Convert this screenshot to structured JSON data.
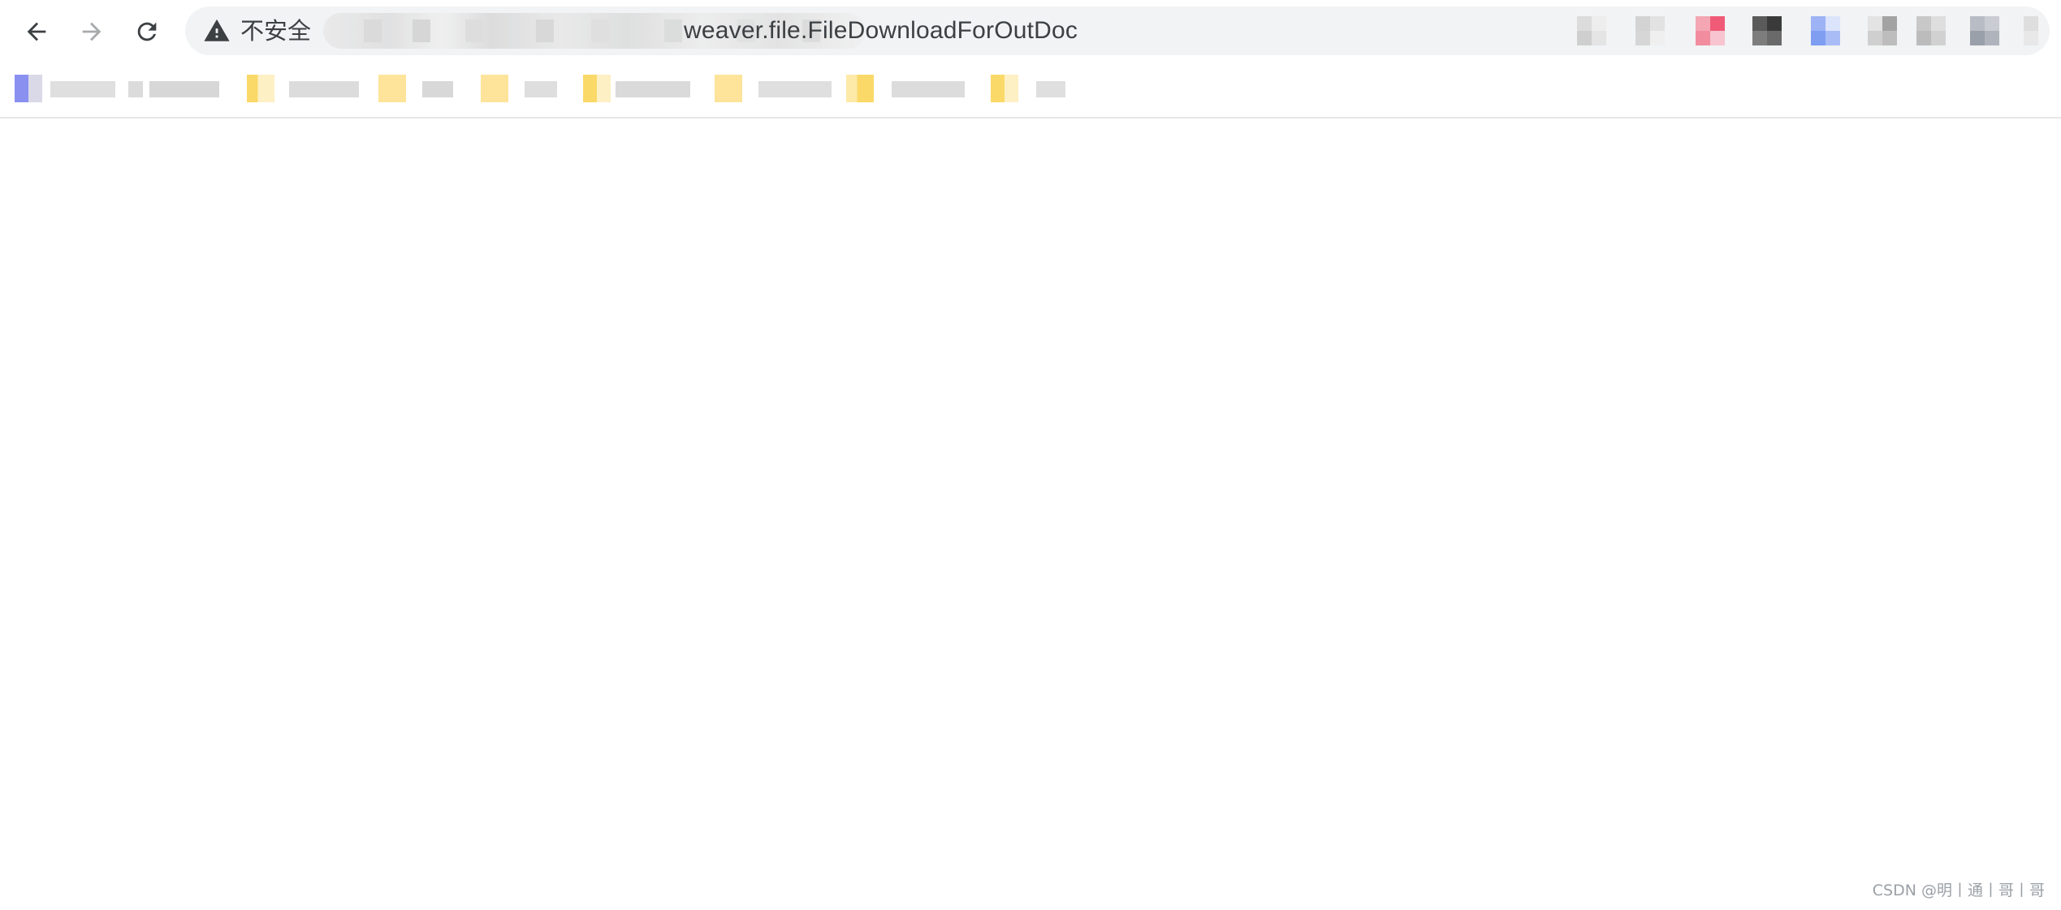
{
  "toolbar": {
    "back_icon": "arrow-left-icon",
    "forward_icon": "arrow-right-icon",
    "reload_icon": "reload-icon"
  },
  "omnibox": {
    "security_icon": "warning-triangle-icon",
    "security_label": "不安全",
    "url_visible": "weaver.file.FileDownloadForOutDoc"
  },
  "bookmarks": {
    "count": 8
  },
  "watermark": "CSDN @明丨通丨哥丨哥",
  "colors": {
    "omnibox_bg": "#f1f3f4",
    "text": "#3c4043",
    "folder": "#fde49a",
    "forward_disabled": "#a8abad"
  }
}
